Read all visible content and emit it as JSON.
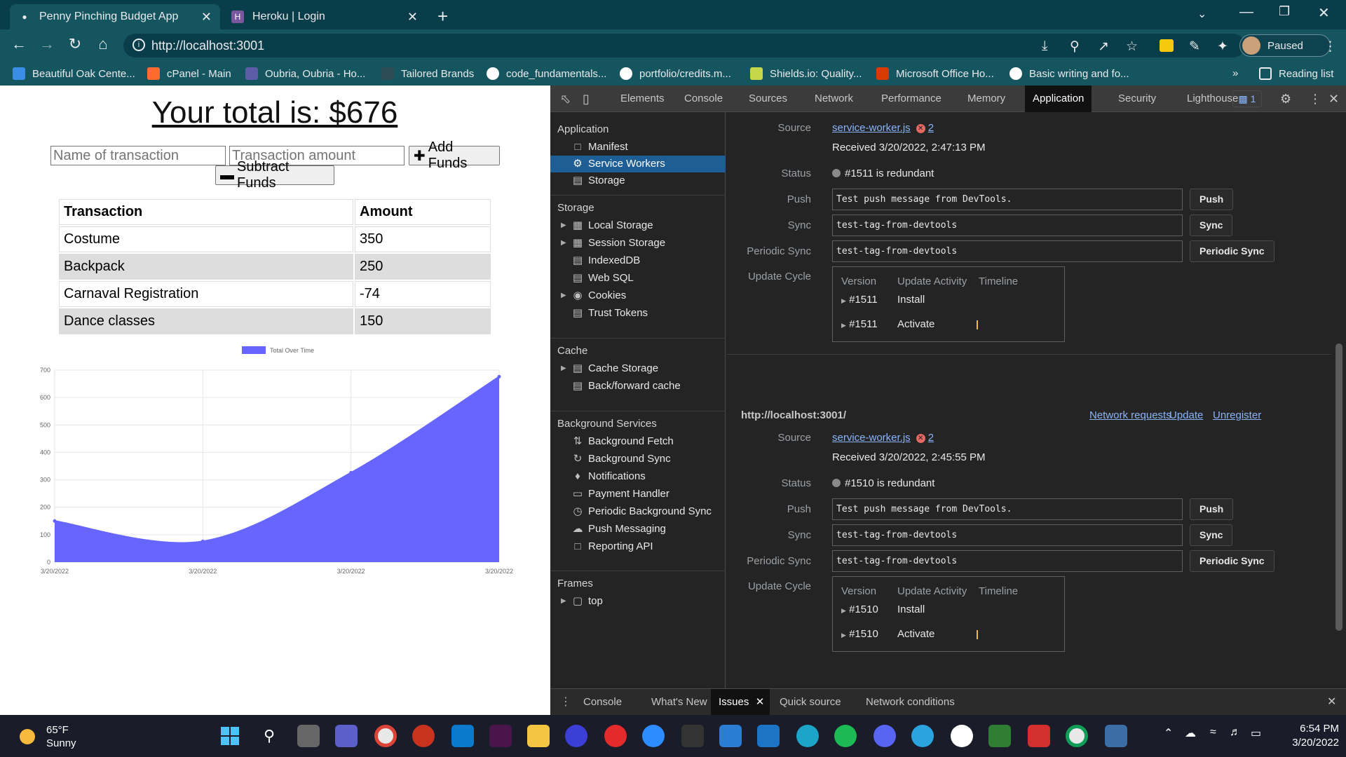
{
  "browser": {
    "tabs": [
      {
        "title": "Penny Pinching Budget App",
        "active": true
      },
      {
        "title": "Heroku | Login",
        "active": false
      }
    ],
    "url": "http://localhost:3001",
    "profile_label": "Paused",
    "bookmarks": [
      "Beautiful Oak Cente...",
      "cPanel - Main",
      "Oubria, Oubria - Ho...",
      "Tailored Brands",
      "code_fundamentals...",
      "portfolio/credits.m...",
      "Shields.io: Quality...",
      "Microsoft Office Ho...",
      "Basic writing and fo..."
    ],
    "reading_list": "Reading list"
  },
  "app": {
    "total_label": "Your total is: $676",
    "name_placeholder": "Name of transaction",
    "amount_placeholder": "Transaction amount",
    "add_label": "Add Funds",
    "subtract_label": "Subtract Funds",
    "table": {
      "headers": [
        "Transaction",
        "Amount"
      ],
      "rows": [
        [
          "Costume",
          "350"
        ],
        [
          "Backpack",
          "250"
        ],
        [
          "Carnaval Registration",
          "-74"
        ],
        [
          "Dance classes",
          "150"
        ]
      ]
    }
  },
  "chart_data": {
    "type": "area",
    "legend": "Total Over Time",
    "legend_position": "top",
    "categories": [
      "3/20/2022",
      "3/20/2022",
      "3/20/2022",
      "3/20/2022"
    ],
    "series": [
      {
        "name": "Total Over Time",
        "values": [
          150,
          76,
          326,
          676
        ],
        "color": "#6666ff"
      }
    ],
    "ylim": [
      0,
      700
    ],
    "yticks": [
      0,
      100,
      200,
      300,
      400,
      500,
      600,
      700
    ],
    "grid": true
  },
  "devtools": {
    "tabs": [
      "Elements",
      "Console",
      "Sources",
      "Network",
      "Performance",
      "Memory",
      "Application",
      "Security",
      "Lighthouse"
    ],
    "active_tab": "Application",
    "issues_count": "1",
    "sidebar": {
      "application": {
        "title": "Application",
        "items": [
          "Manifest",
          "Service Workers",
          "Storage"
        ]
      },
      "storage": {
        "title": "Storage",
        "items": [
          "Local Storage",
          "Session Storage",
          "IndexedDB",
          "Web SQL",
          "Cookies",
          "Trust Tokens"
        ]
      },
      "cache": {
        "title": "Cache",
        "items": [
          "Cache Storage",
          "Back/forward cache"
        ]
      },
      "background": {
        "title": "Background Services",
        "items": [
          "Background Fetch",
          "Background Sync",
          "Notifications",
          "Payment Handler",
          "Periodic Background Sync",
          "Push Messaging",
          "Reporting API"
        ]
      },
      "frames": {
        "title": "Frames",
        "items": [
          "top"
        ]
      }
    },
    "labels": {
      "source": "Source",
      "status": "Status",
      "push": "Push",
      "sync": "Sync",
      "periodic_sync": "Periodic Sync",
      "update_cycle": "Update Cycle",
      "version": "Version",
      "update_activity": "Update Activity",
      "timeline": "Timeline"
    },
    "buttons": {
      "push": "Push",
      "sync": "Sync",
      "periodic_sync": "Periodic Sync"
    },
    "workers": [
      {
        "source": "service-worker.js",
        "errors": "2",
        "received": "Received 3/20/2022, 2:47:13 PM",
        "status": "#1511 is redundant",
        "push_value": "Test push message from DevTools.",
        "sync_value": "test-tag-from-devtools",
        "periodic_value": "test-tag-from-devtools",
        "cycle": [
          {
            "version": "#1511",
            "activity": "Install"
          },
          {
            "version": "#1511",
            "activity": "Activate"
          }
        ]
      },
      {
        "origin": "http://localhost:3001/",
        "links": [
          "Network requests",
          "Update",
          "Unregister"
        ],
        "source": "service-worker.js",
        "errors": "2",
        "received": "Received 3/20/2022, 2:45:55 PM",
        "status": "#1510 is redundant",
        "push_value": "Test push message from DevTools.",
        "sync_value": "test-tag-from-devtools",
        "periodic_value": "test-tag-from-devtools",
        "cycle": [
          {
            "version": "#1510",
            "activity": "Install"
          },
          {
            "version": "#1510",
            "activity": "Activate"
          }
        ]
      }
    ],
    "drawer_tabs": [
      "Console",
      "What's New",
      "Issues",
      "Quick source",
      "Network conditions"
    ],
    "drawer_active": "Issues"
  },
  "taskbar": {
    "temp": "65°F",
    "condition": "Sunny",
    "time": "6:54 PM",
    "date": "3/20/2022"
  }
}
